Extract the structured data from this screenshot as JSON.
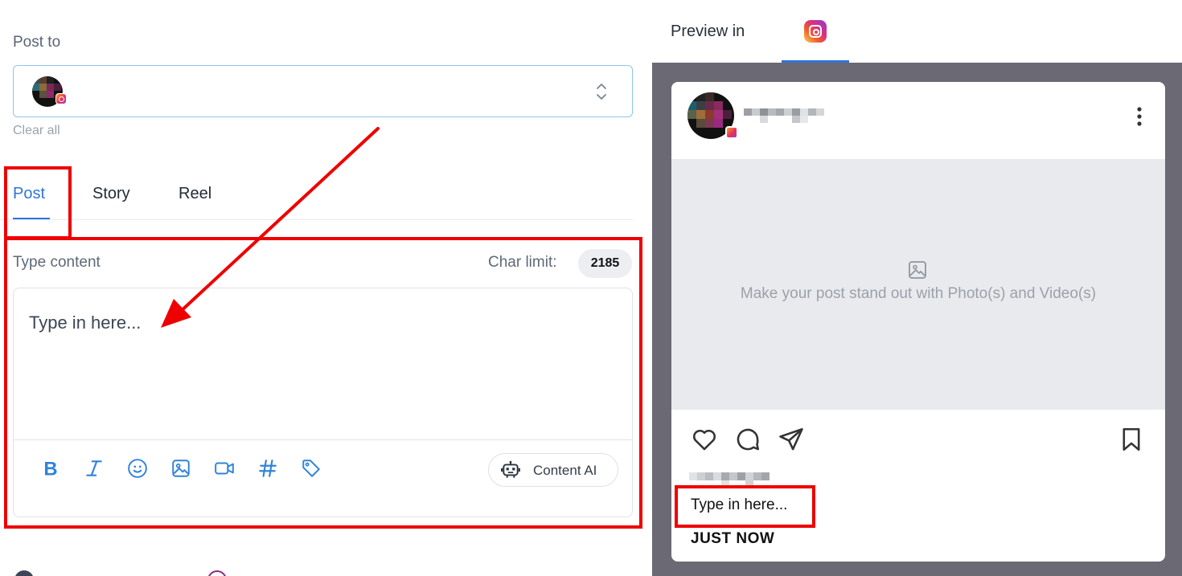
{
  "composer": {
    "post_to_label": "Post to",
    "clear_all_label": "Clear all",
    "tabs": [
      {
        "label": "Post",
        "active": true
      },
      {
        "label": "Story",
        "active": false
      },
      {
        "label": "Reel",
        "active": false
      }
    ],
    "content_label": "Type content",
    "char_limit_label": "Char limit:",
    "char_limit_value": "2185",
    "editor_placeholder": "Type in here...",
    "toolbar_icons": [
      "bold-icon",
      "italic-icon",
      "emoji-icon",
      "image-icon",
      "video-icon",
      "hashtag-icon",
      "tag-icon"
    ],
    "content_ai_label": "Content AI"
  },
  "preview": {
    "label": "Preview in",
    "network_icon": "instagram-icon",
    "media_placeholder": "Make your post stand out with Photo(s) and Video(s)",
    "caption": "Type in here...",
    "timestamp": "JUST NOW"
  },
  "colors": {
    "accent": "#2f75d6",
    "annotation": "#ee0000",
    "preview_background": "#6b6974",
    "media_placeholder_bg": "#e9eaed"
  }
}
